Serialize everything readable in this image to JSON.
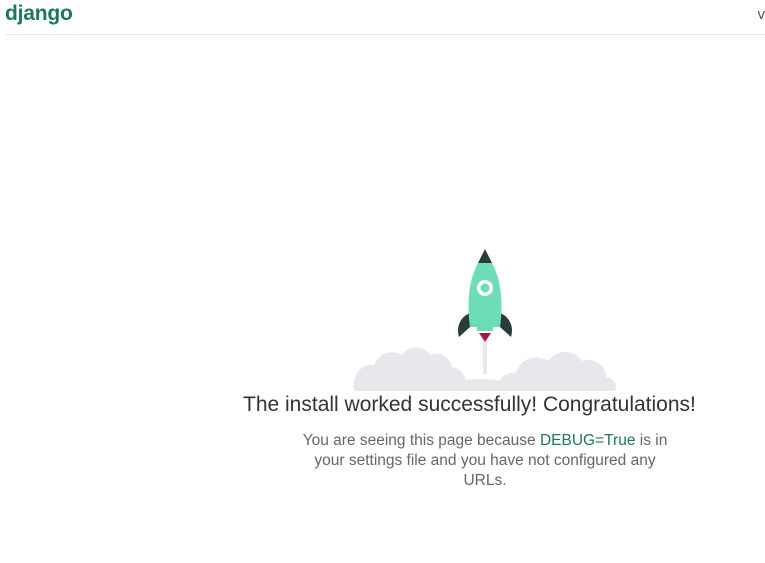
{
  "header": {
    "logo": "django",
    "version": "v"
  },
  "main": {
    "title": "The install worked successfully! Congratulations!",
    "desc_before": "You are seeing this page because ",
    "desc_code": "DEBUG=True",
    "desc_after": " is in your settings file and you have not configured any URLs."
  },
  "colors": {
    "brand": "#1c7a52",
    "rocket_body": "#6dddb7",
    "rocket_fins": "#2b3a3b",
    "flame": "#a3184a",
    "clouds": "#e8e8ec"
  },
  "icons": {
    "illustration": "rocket-icon",
    "clouds": "clouds-icon"
  }
}
